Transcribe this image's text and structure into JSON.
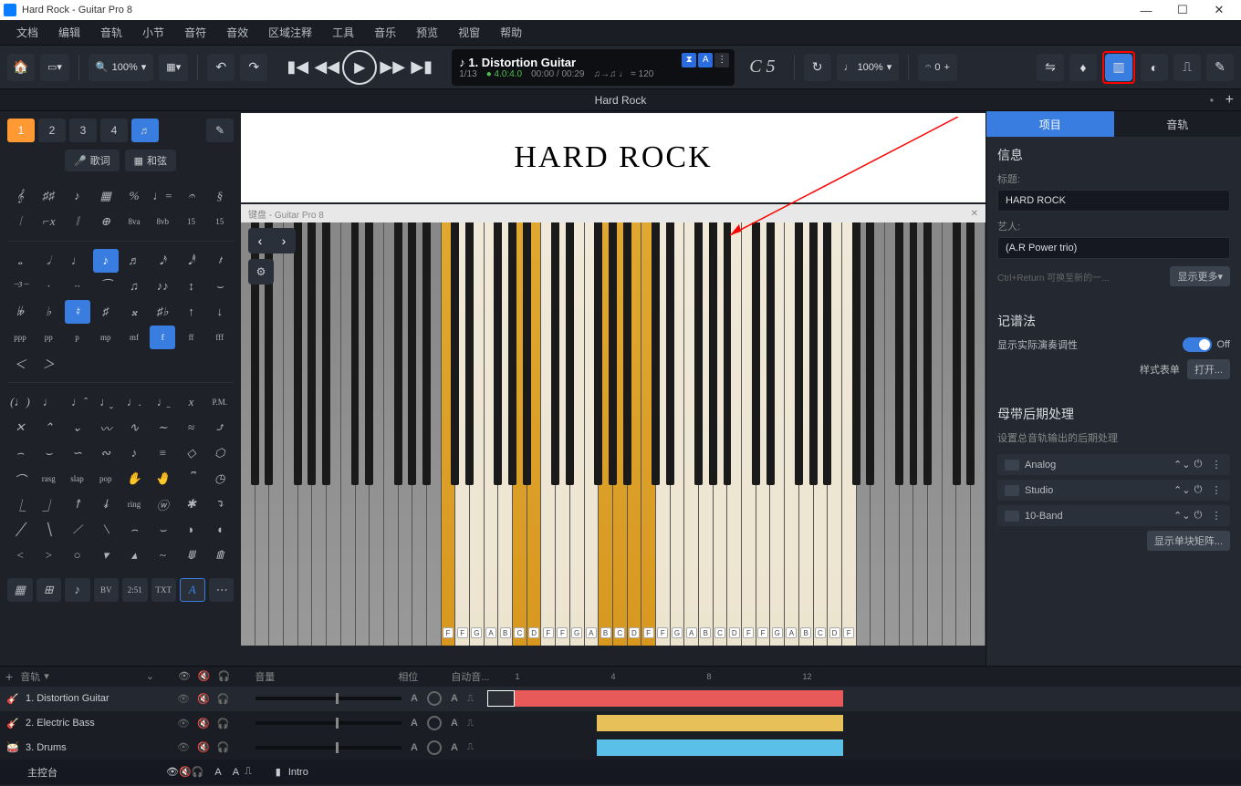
{
  "window": {
    "title": "Hard Rock - Guitar Pro 8"
  },
  "menu": [
    "文档",
    "编辑",
    "音轨",
    "小节",
    "音符",
    "音效",
    "区域注释",
    "工具",
    "音乐",
    "预览",
    "视窗",
    "帮助"
  ],
  "toolbar": {
    "zoom": "100%",
    "track_name": "1. Distortion Guitar",
    "bar_count": "1/13",
    "time_sig": "4.0:4.0",
    "time_pos": "00:00 / 00:29",
    "tempo": "♩ = 120",
    "note_display": "C 5",
    "note_zoom": "100%",
    "note_val": "0"
  },
  "doc_tab": "Hard Rock",
  "score": {
    "title": "HARD ROCK"
  },
  "keyboard": {
    "header": "键盘 - Guitar Pro 8",
    "labels": [
      "F",
      "F",
      "G",
      "A",
      "B",
      "C",
      "D",
      "F",
      "F",
      "G",
      "A",
      "B",
      "C",
      "D",
      "F",
      "F",
      "G",
      "A",
      "B",
      "C",
      "D",
      "F",
      "F",
      "G",
      "A",
      "B",
      "C",
      "D",
      "F"
    ]
  },
  "voice_buttons": [
    "1",
    "2",
    "3",
    "4"
  ],
  "pills": {
    "lyrics": "歌词",
    "chords": "和弦"
  },
  "inspector": {
    "tab_active": "项目",
    "tab_other": "音轨",
    "info_header": "信息",
    "title_label": "标题:",
    "title_value": "HARD ROCK",
    "artist_label": "艺人:",
    "artist_value": "(A.R Power trio)",
    "newline_hint": "Ctrl+Return 可换至新的一...",
    "show_more": "显示更多▾",
    "notation_header": "记谱法",
    "show_tuning": "显示实际演奏调性",
    "toggle_state": "Off",
    "stylesheet": "样式表单",
    "open": "打开...",
    "mastering_header": "母带后期处理",
    "mastering_desc": "设置总音轨输出的后期处理",
    "fx": [
      "Analog",
      "Studio",
      "10-Band"
    ],
    "show_matrix": "显示单块矩阵..."
  },
  "tracks": {
    "header_label": "音轨",
    "col_vol": "音量",
    "col_pan": "相位",
    "col_auto": "自动音...",
    "ruler": [
      "1",
      "4",
      "8",
      "12"
    ],
    "rows": [
      {
        "name": "1. Distortion Guitar",
        "icon_color": "#e85a5a"
      },
      {
        "name": "2. Electric Bass",
        "icon_color": "#e8c05a"
      },
      {
        "name": "3. Drums",
        "icon_color": "#5ac0e8"
      }
    ],
    "master": "主控台",
    "section": "Intro"
  }
}
